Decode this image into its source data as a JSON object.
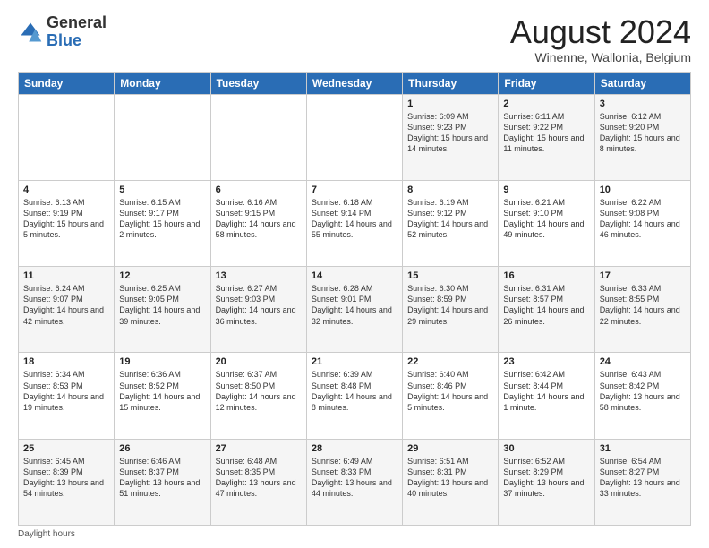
{
  "header": {
    "logo_general": "General",
    "logo_blue": "Blue",
    "month_title": "August 2024",
    "subtitle": "Winenne, Wallonia, Belgium"
  },
  "weekdays": [
    "Sunday",
    "Monday",
    "Tuesday",
    "Wednesday",
    "Thursday",
    "Friday",
    "Saturday"
  ],
  "footer": "Daylight hours",
  "weeks": [
    [
      {
        "day": "",
        "info": ""
      },
      {
        "day": "",
        "info": ""
      },
      {
        "day": "",
        "info": ""
      },
      {
        "day": "",
        "info": ""
      },
      {
        "day": "1",
        "info": "Sunrise: 6:09 AM\nSunset: 9:23 PM\nDaylight: 15 hours\nand 14 minutes."
      },
      {
        "day": "2",
        "info": "Sunrise: 6:11 AM\nSunset: 9:22 PM\nDaylight: 15 hours\nand 11 minutes."
      },
      {
        "day": "3",
        "info": "Sunrise: 6:12 AM\nSunset: 9:20 PM\nDaylight: 15 hours\nand 8 minutes."
      }
    ],
    [
      {
        "day": "4",
        "info": "Sunrise: 6:13 AM\nSunset: 9:19 PM\nDaylight: 15 hours\nand 5 minutes."
      },
      {
        "day": "5",
        "info": "Sunrise: 6:15 AM\nSunset: 9:17 PM\nDaylight: 15 hours\nand 2 minutes."
      },
      {
        "day": "6",
        "info": "Sunrise: 6:16 AM\nSunset: 9:15 PM\nDaylight: 14 hours\nand 58 minutes."
      },
      {
        "day": "7",
        "info": "Sunrise: 6:18 AM\nSunset: 9:14 PM\nDaylight: 14 hours\nand 55 minutes."
      },
      {
        "day": "8",
        "info": "Sunrise: 6:19 AM\nSunset: 9:12 PM\nDaylight: 14 hours\nand 52 minutes."
      },
      {
        "day": "9",
        "info": "Sunrise: 6:21 AM\nSunset: 9:10 PM\nDaylight: 14 hours\nand 49 minutes."
      },
      {
        "day": "10",
        "info": "Sunrise: 6:22 AM\nSunset: 9:08 PM\nDaylight: 14 hours\nand 46 minutes."
      }
    ],
    [
      {
        "day": "11",
        "info": "Sunrise: 6:24 AM\nSunset: 9:07 PM\nDaylight: 14 hours\nand 42 minutes."
      },
      {
        "day": "12",
        "info": "Sunrise: 6:25 AM\nSunset: 9:05 PM\nDaylight: 14 hours\nand 39 minutes."
      },
      {
        "day": "13",
        "info": "Sunrise: 6:27 AM\nSunset: 9:03 PM\nDaylight: 14 hours\nand 36 minutes."
      },
      {
        "day": "14",
        "info": "Sunrise: 6:28 AM\nSunset: 9:01 PM\nDaylight: 14 hours\nand 32 minutes."
      },
      {
        "day": "15",
        "info": "Sunrise: 6:30 AM\nSunset: 8:59 PM\nDaylight: 14 hours\nand 29 minutes."
      },
      {
        "day": "16",
        "info": "Sunrise: 6:31 AM\nSunset: 8:57 PM\nDaylight: 14 hours\nand 26 minutes."
      },
      {
        "day": "17",
        "info": "Sunrise: 6:33 AM\nSunset: 8:55 PM\nDaylight: 14 hours\nand 22 minutes."
      }
    ],
    [
      {
        "day": "18",
        "info": "Sunrise: 6:34 AM\nSunset: 8:53 PM\nDaylight: 14 hours\nand 19 minutes."
      },
      {
        "day": "19",
        "info": "Sunrise: 6:36 AM\nSunset: 8:52 PM\nDaylight: 14 hours\nand 15 minutes."
      },
      {
        "day": "20",
        "info": "Sunrise: 6:37 AM\nSunset: 8:50 PM\nDaylight: 14 hours\nand 12 minutes."
      },
      {
        "day": "21",
        "info": "Sunrise: 6:39 AM\nSunset: 8:48 PM\nDaylight: 14 hours\nand 8 minutes."
      },
      {
        "day": "22",
        "info": "Sunrise: 6:40 AM\nSunset: 8:46 PM\nDaylight: 14 hours\nand 5 minutes."
      },
      {
        "day": "23",
        "info": "Sunrise: 6:42 AM\nSunset: 8:44 PM\nDaylight: 14 hours\nand 1 minute."
      },
      {
        "day": "24",
        "info": "Sunrise: 6:43 AM\nSunset: 8:42 PM\nDaylight: 13 hours\nand 58 minutes."
      }
    ],
    [
      {
        "day": "25",
        "info": "Sunrise: 6:45 AM\nSunset: 8:39 PM\nDaylight: 13 hours\nand 54 minutes."
      },
      {
        "day": "26",
        "info": "Sunrise: 6:46 AM\nSunset: 8:37 PM\nDaylight: 13 hours\nand 51 minutes."
      },
      {
        "day": "27",
        "info": "Sunrise: 6:48 AM\nSunset: 8:35 PM\nDaylight: 13 hours\nand 47 minutes."
      },
      {
        "day": "28",
        "info": "Sunrise: 6:49 AM\nSunset: 8:33 PM\nDaylight: 13 hours\nand 44 minutes."
      },
      {
        "day": "29",
        "info": "Sunrise: 6:51 AM\nSunset: 8:31 PM\nDaylight: 13 hours\nand 40 minutes."
      },
      {
        "day": "30",
        "info": "Sunrise: 6:52 AM\nSunset: 8:29 PM\nDaylight: 13 hours\nand 37 minutes."
      },
      {
        "day": "31",
        "info": "Sunrise: 6:54 AM\nSunset: 8:27 PM\nDaylight: 13 hours\nand 33 minutes."
      }
    ]
  ]
}
